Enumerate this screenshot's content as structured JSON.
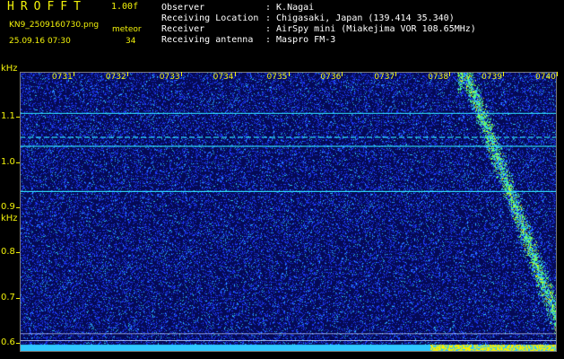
{
  "header": {
    "app_title": "HROFFT",
    "app_version": "1.00f",
    "file_name": "KN9_2509160730.png",
    "meteor_label": "meteor",
    "date_time": "25.09.16 07:30",
    "meteor_count": "34",
    "info": [
      {
        "label": "Observer",
        "value": ": K.Nagai"
      },
      {
        "label": "Receiving Location",
        "value": ": Chigasaki, Japan (139.414 35.340)"
      },
      {
        "label": "Receiver",
        "value": ": AirSpy mini (Miakejima VOR 108.65MHz)"
      },
      {
        "label": "Receiving antenna",
        "value": ": Maspro FM-3"
      }
    ]
  },
  "colors": {
    "background": "#050a55",
    "label_yellow": "#f2f20a",
    "noise_blue": "#1e3cff",
    "noise_cyan": "#2ec8ff",
    "signal_green": "#55ff70",
    "signal_yellow": "#f8f000",
    "baseline_cyan": "#30e8ff"
  },
  "chart_data": {
    "type": "heatmap",
    "title": "",
    "xlabel": "",
    "ylabel": "kHz",
    "x_tick_labels": [
      "0731",
      "0732",
      "0733",
      "0734",
      "0735",
      "0736",
      "0737",
      "0738",
      "0739",
      "0740"
    ],
    "y_tick_labels": [
      "1.1",
      "1.0",
      "0.9",
      "0.8",
      "0.7",
      "0.6"
    ],
    "y_ticks": [
      1.1,
      1.0,
      0.9,
      0.8,
      0.7,
      0.6
    ],
    "xlim": [
      "07:30",
      "07:40"
    ],
    "ylim": [
      0.58,
      1.2
    ],
    "y_unit_labels": [
      "kHz",
      "kHz"
    ],
    "steady_lines_khz": [
      1.108,
      1.055,
      1.035,
      0.935,
      0.62,
      0.605
    ],
    "doppler_trace": {
      "start_time": "07:38.3",
      "end_time": "07:40.0",
      "start_khz": 1.2,
      "end_khz": 0.65
    },
    "grid": false,
    "legend": "none"
  }
}
